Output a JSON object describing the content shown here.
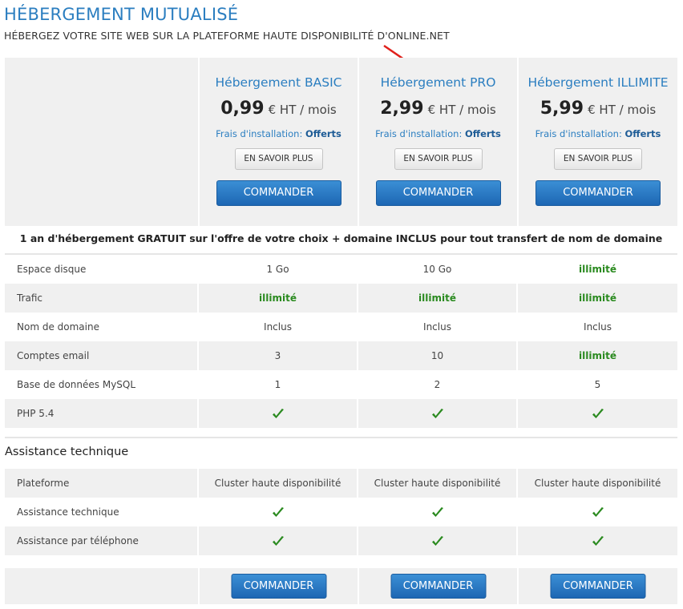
{
  "header": {
    "title": "HÉBERGEMENT MUTUALISÉ",
    "subtitle": "HÉBERGEZ VOTRE SITE WEB SUR LA PLATEFORME HAUTE DISPONIBILITÉ D'ONLINE.NET"
  },
  "plans": [
    {
      "name": "Hébergement BASIC",
      "price": "0,99",
      "price_unit": "€ HT / mois",
      "fees_label": "Frais d'installation:",
      "fees_value": "Offerts",
      "info_label": "EN SAVOIR PLUS",
      "order_label": "COMMANDER"
    },
    {
      "name": "Hébergement PRO",
      "price": "2,99",
      "price_unit": "€ HT / mois",
      "fees_label": "Frais d'installation:",
      "fees_value": "Offerts",
      "info_label": "EN SAVOIR PLUS",
      "order_label": "COMMANDER"
    },
    {
      "name": "Hébergement ILLIMITE",
      "price": "5,99",
      "price_unit": "€ HT / mois",
      "fees_label": "Frais d'installation:",
      "fees_value": "Offerts",
      "info_label": "EN SAVOIR PLUS",
      "order_label": "COMMANDER"
    }
  ],
  "promo": "1 an d'hébergement GRATUIT sur l'offre de votre choix + domaine INCLUS pour tout transfert de nom de domaine",
  "features": [
    {
      "label": "Espace disque",
      "values": [
        "1 Go",
        "10 Go",
        "illimité"
      ]
    },
    {
      "label": "Trafic",
      "values": [
        "illimité",
        "illimité",
        "illimité"
      ]
    },
    {
      "label": "Nom de domaine",
      "values": [
        "Inclus",
        "Inclus",
        "Inclus"
      ]
    },
    {
      "label": "Comptes email",
      "values": [
        "3",
        "10",
        "illimité"
      ]
    },
    {
      "label": "Base de données MySQL",
      "values": [
        "1",
        "2",
        "5"
      ]
    },
    {
      "label": "PHP 5.4",
      "values": [
        "check-icon",
        "check-icon",
        "check-icon"
      ]
    }
  ],
  "support": {
    "title": "Assistance technique",
    "rows": [
      {
        "label": "Plateforme",
        "values": [
          "Cluster haute disponibilité",
          "Cluster haute disponibilité",
          "Cluster haute disponibilité"
        ]
      },
      {
        "label": "Assistance technique",
        "values": [
          "check-icon",
          "check-icon",
          "check-icon"
        ]
      },
      {
        "label": "Assistance par téléphone",
        "values": [
          "check-icon",
          "check-icon",
          "check-icon"
        ]
      }
    ]
  },
  "footer": {
    "order_labels": [
      "COMMANDER",
      "COMMANDER",
      "COMMANDER"
    ]
  },
  "colors": {
    "accent": "#2b7ec0",
    "unlimited": "#2a8a1f",
    "button": "#1d66b3",
    "row_shade": "#f0f0f0",
    "arrow": "#e0201b"
  }
}
